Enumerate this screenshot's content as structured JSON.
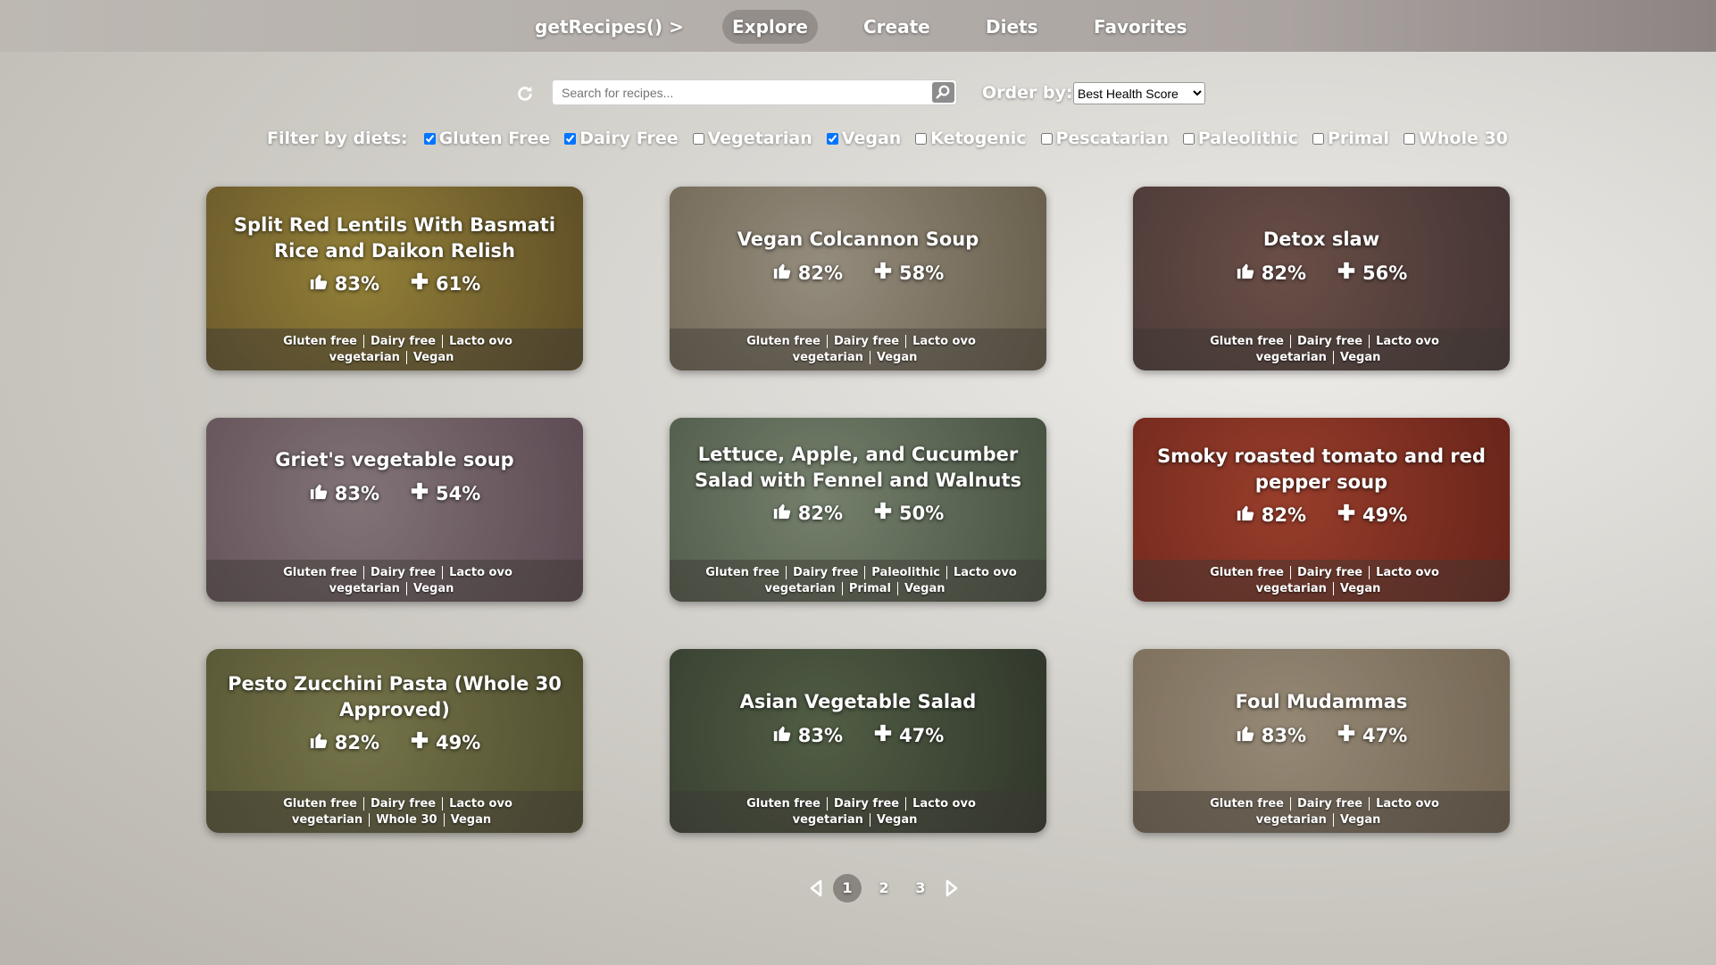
{
  "nav": {
    "brand": "getRecipes() >",
    "items": [
      "Explore",
      "Create",
      "Diets",
      "Favorites"
    ],
    "active": "Explore"
  },
  "search": {
    "placeholder": "Search for recipes...",
    "value": "",
    "refresh_icon": "refresh-icon",
    "search_icon": "search-icon"
  },
  "order": {
    "label": "Order by:",
    "selected": "Best Health Score"
  },
  "filters": {
    "label": "Filter by diets:",
    "diets": [
      {
        "label": "Gluten Free",
        "checked": true
      },
      {
        "label": "Dairy Free",
        "checked": true
      },
      {
        "label": "Vegetarian",
        "checked": false
      },
      {
        "label": "Vegan",
        "checked": true
      },
      {
        "label": "Ketogenic",
        "checked": false
      },
      {
        "label": "Pescatarian",
        "checked": false
      },
      {
        "label": "Paleolithic",
        "checked": false
      },
      {
        "label": "Primal",
        "checked": false
      },
      {
        "label": "Whole 30",
        "checked": false
      }
    ]
  },
  "recipes": [
    {
      "title": "Split Red Lentils With Basmati Rice and Daikon Relish",
      "likes": "83%",
      "health": "61%",
      "tags": [
        "Gluten free",
        "Dairy free",
        "Lacto ovo vegetarian",
        "Vegan"
      ],
      "color_a": "#b09a3f",
      "color_b": "#6e5a2a"
    },
    {
      "title": "Vegan Colcannon Soup",
      "likes": "82%",
      "health": "58%",
      "tags": [
        "Gluten free",
        "Dairy free",
        "Lacto ovo vegetarian",
        "Vegan"
      ],
      "color_a": "#b3aa98",
      "color_b": "#7a6f58"
    },
    {
      "title": "Detox slaw",
      "likes": "82%",
      "health": "56%",
      "tags": [
        "Gluten free",
        "Dairy free",
        "Lacto ovo vegetarian",
        "Vegan"
      ],
      "color_a": "#7d5a52",
      "color_b": "#4c3a3a"
    },
    {
      "title": "Griet's vegetable soup",
      "likes": "83%",
      "health": "54%",
      "tags": [
        "Gluten free",
        "Dairy free",
        "Lacto ovo vegetarian",
        "Vegan"
      ],
      "color_a": "#9a8a90",
      "color_b": "#6b5560"
    },
    {
      "title": "Lettuce, Apple, and Cucumber Salad with Fennel and Walnuts",
      "likes": "82%",
      "health": "50%",
      "tags": [
        "Gluten free",
        "Dairy free",
        "Paleolithic",
        "Lacto ovo vegetarian",
        "Primal",
        "Vegan"
      ],
      "color_a": "#8a9a82",
      "color_b": "#4f5e4a"
    },
    {
      "title": "Smoky roasted tomato and red pepper soup",
      "likes": "82%",
      "health": "49%",
      "tags": [
        "Gluten free",
        "Dairy free",
        "Lacto ovo vegetarian",
        "Vegan"
      ],
      "color_a": "#b8452f",
      "color_b": "#7a2418"
    },
    {
      "title": "Pesto Zucchini Pasta (Whole 30 Approved)",
      "likes": "82%",
      "health": "49%",
      "tags": [
        "Gluten free",
        "Dairy free",
        "Lacto ovo vegetarian",
        "Whole 30",
        "Vegan"
      ],
      "color_a": "#8a8a55",
      "color_b": "#5a5a34"
    },
    {
      "title": "Asian Vegetable Salad",
      "likes": "83%",
      "health": "47%",
      "tags": [
        "Gluten free",
        "Dairy free",
        "Lacto ovo vegetarian",
        "Vegan"
      ],
      "color_a": "#5d6e4f",
      "color_b": "#323c2e"
    },
    {
      "title": "Foul Mudammas",
      "likes": "83%",
      "health": "47%",
      "tags": [
        "Gluten free",
        "Dairy free",
        "Lacto ovo vegetarian",
        "Vegan"
      ],
      "color_a": "#b4a58e",
      "color_b": "#8a7a63"
    }
  ],
  "pagination": {
    "pages": [
      "1",
      "2",
      "3"
    ],
    "current": "1"
  }
}
